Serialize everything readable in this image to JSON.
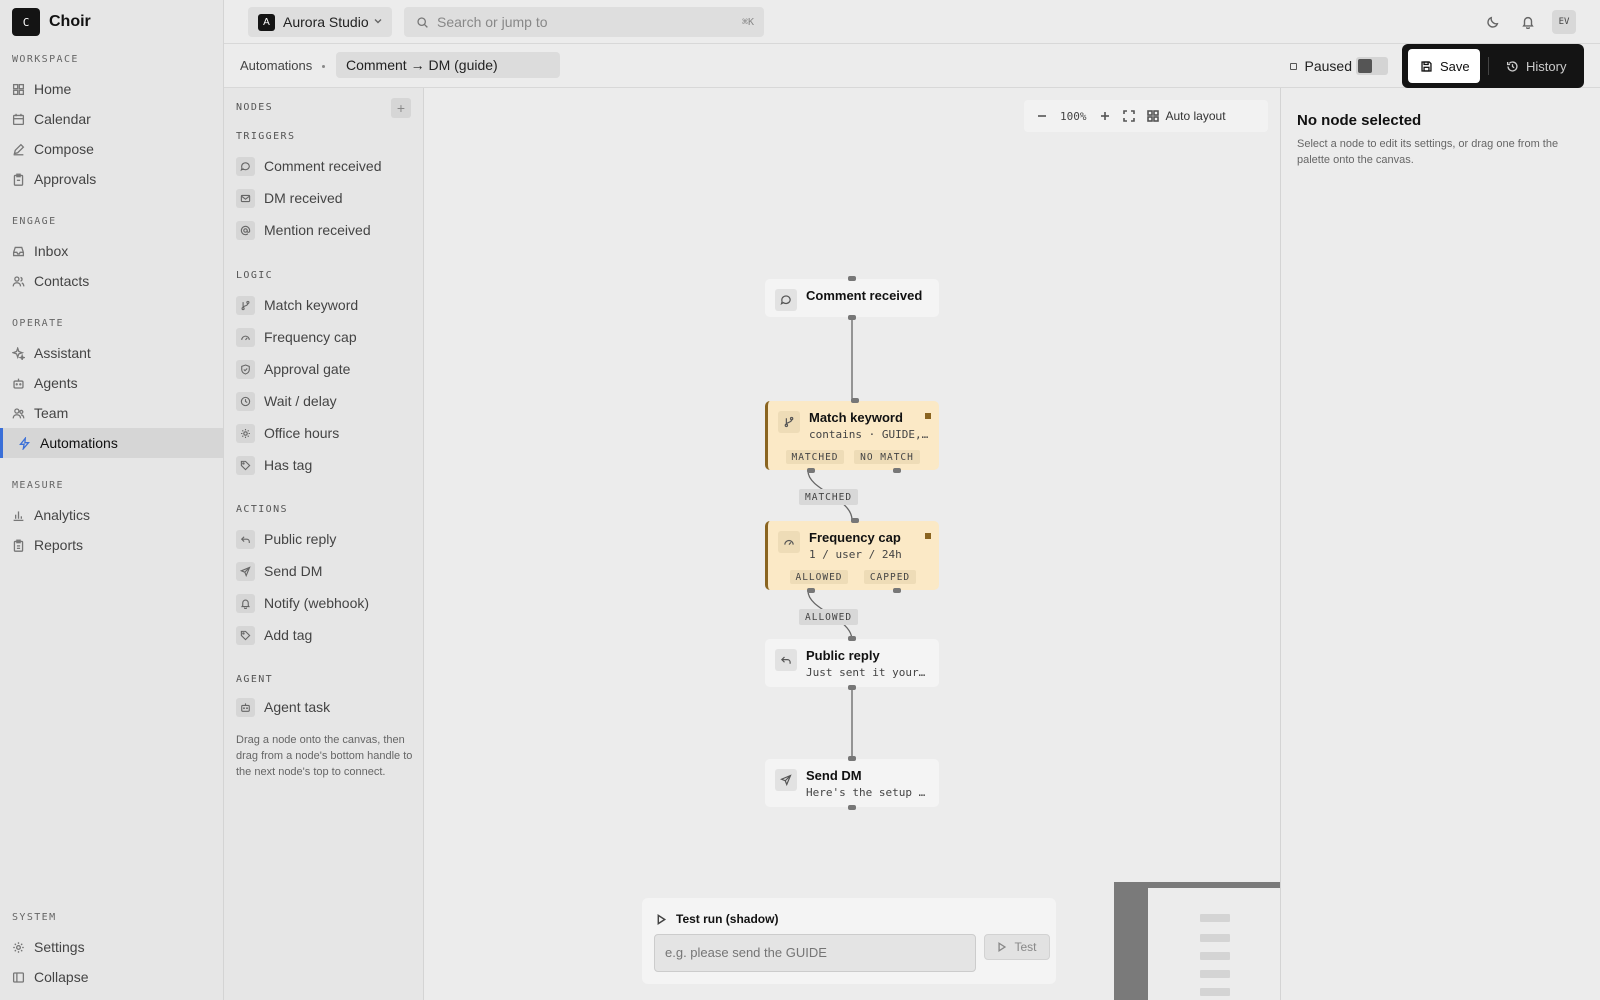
{
  "app": {
    "name": "Choir",
    "logo_letter": "C"
  },
  "sidebar": {
    "sections": [
      {
        "label": "WORKSPACE",
        "items": [
          {
            "label": "Home",
            "icon": "grid-icon"
          },
          {
            "label": "Calendar",
            "icon": "calendar-icon"
          },
          {
            "label": "Compose",
            "icon": "pen-icon"
          },
          {
            "label": "Approvals",
            "icon": "clipboard-icon"
          }
        ]
      },
      {
        "label": "ENGAGE",
        "items": [
          {
            "label": "Inbox",
            "icon": "inbox-icon"
          },
          {
            "label": "Contacts",
            "icon": "contacts-icon"
          }
        ]
      },
      {
        "label": "OPERATE",
        "items": [
          {
            "label": "Assistant",
            "icon": "sparkle-icon"
          },
          {
            "label": "Agents",
            "icon": "bot-icon"
          },
          {
            "label": "Team",
            "icon": "users-icon"
          },
          {
            "label": "Automations",
            "icon": "bolt-icon",
            "active": true
          }
        ]
      },
      {
        "label": "MEASURE",
        "items": [
          {
            "label": "Analytics",
            "icon": "bar-chart-icon"
          },
          {
            "label": "Reports",
            "icon": "report-icon"
          }
        ]
      },
      {
        "label": "SYSTEM",
        "items": [
          {
            "label": "Settings",
            "icon": "gear-icon"
          },
          {
            "label": "Collapse",
            "icon": "panel-collapse-icon"
          }
        ]
      }
    ]
  },
  "topbar": {
    "workspace": {
      "badge": "A",
      "name": "Aurora Studio"
    },
    "search": {
      "placeholder": "Search or jump to",
      "shortcut": "⌘K"
    },
    "avatar_initials": "EV"
  },
  "subbar": {
    "breadcrumb": "Automations",
    "automation_name": "Comment → DM (guide)",
    "status_label": "Paused",
    "save_label": "Save",
    "history_label": "History"
  },
  "palette": {
    "heading": "NODES",
    "groups": [
      {
        "label": "TRIGGERS",
        "items": [
          {
            "label": "Comment received",
            "icon": "comment-icon"
          },
          {
            "label": "DM received",
            "icon": "mail-icon"
          },
          {
            "label": "Mention received",
            "icon": "at-icon"
          }
        ]
      },
      {
        "label": "LOGIC",
        "items": [
          {
            "label": "Match keyword",
            "icon": "branch-icon"
          },
          {
            "label": "Frequency cap",
            "icon": "gauge-icon"
          },
          {
            "label": "Approval gate",
            "icon": "shield-icon"
          },
          {
            "label": "Wait / delay",
            "icon": "clock-icon"
          },
          {
            "label": "Office hours",
            "icon": "sun-icon"
          },
          {
            "label": "Has tag",
            "icon": "tag-icon"
          }
        ]
      },
      {
        "label": "ACTIONS",
        "items": [
          {
            "label": "Public reply",
            "icon": "reply-icon"
          },
          {
            "label": "Send DM",
            "icon": "send-icon"
          },
          {
            "label": "Notify (webhook)",
            "icon": "bell-icon"
          },
          {
            "label": "Add tag",
            "icon": "tag-icon"
          }
        ]
      },
      {
        "label": "AGENT",
        "items": [
          {
            "label": "Agent task",
            "icon": "bot-icon"
          }
        ]
      }
    ],
    "hint": "Drag a node onto the canvas, then drag from a node's bottom handle to the next node's top to connect."
  },
  "canvas": {
    "zoom": "100%",
    "auto_layout_label": "Auto layout",
    "nodes": [
      {
        "title": "Comment received",
        "icon": "comment-icon"
      },
      {
        "title": "Match keyword",
        "subtitle": "contains · GUIDE, guide",
        "icon": "branch-icon",
        "warning": true,
        "ports": [
          "MATCHED",
          "NO MATCH"
        ]
      },
      {
        "title": "Frequency cap",
        "subtitle": "1 / user / 24h",
        "icon": "gauge-icon",
        "warning": true,
        "ports": [
          "ALLOWED",
          "CAPPED"
        ]
      },
      {
        "title": "Public reply",
        "subtitle": "Just sent it your way!",
        "icon": "reply-icon"
      },
      {
        "title": "Send DM",
        "subtitle": "Here's the setup guide",
        "icon": "send-icon"
      }
    ],
    "edge_labels": [
      "MATCHED",
      "ALLOWED"
    ],
    "test_run": {
      "title": "Test run (shadow)",
      "placeholder": "e.g. please send the GUIDE",
      "button_label": "Test"
    }
  },
  "inspector": {
    "title": "No node selected",
    "description": "Select a node to edit its settings, or drag one from the palette onto the canvas."
  }
}
